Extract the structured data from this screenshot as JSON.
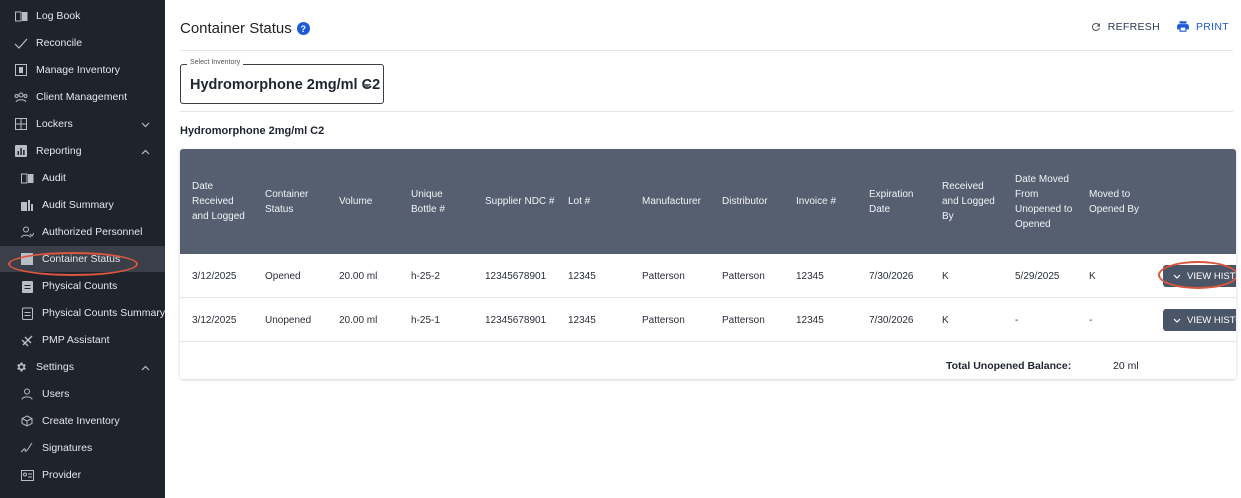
{
  "sidebar": {
    "items": [
      {
        "label": "Log Book",
        "icon": "book-icon"
      },
      {
        "label": "Reconcile",
        "icon": "check-icon"
      },
      {
        "label": "Manage Inventory",
        "icon": "inventory-icon"
      },
      {
        "label": "Client Management",
        "icon": "clients-icon"
      },
      {
        "label": "Lockers",
        "icon": "lockers-icon",
        "chevron": "down"
      },
      {
        "label": "Reporting",
        "icon": "reporting-icon",
        "chevron": "up"
      },
      {
        "label": "Audit",
        "icon": "audit-icon"
      },
      {
        "label": "Audit Summary",
        "icon": "audit-summary-icon"
      },
      {
        "label": "Authorized Personnel",
        "icon": "personnel-icon"
      },
      {
        "label": "Container Status",
        "icon": "container-icon",
        "active": true
      },
      {
        "label": "Physical Counts",
        "icon": "clipboard-icon"
      },
      {
        "label": "Physical Counts Summary",
        "icon": "clipboard-summary-icon"
      },
      {
        "label": "PMP Assistant",
        "icon": "pmp-icon"
      },
      {
        "label": "Settings",
        "icon": "gear-icon",
        "chevron": "up"
      },
      {
        "label": "Users",
        "icon": "user-icon"
      },
      {
        "label": "Create Inventory",
        "icon": "box-icon"
      },
      {
        "label": "Signatures",
        "icon": "signature-icon"
      },
      {
        "label": "Provider",
        "icon": "provider-icon"
      }
    ]
  },
  "header": {
    "title": "Container Status",
    "help": "?",
    "refresh_label": "REFRESH",
    "print_label": "PRINT"
  },
  "select": {
    "legend": "Select Inventory",
    "value": "Hydromorphone 2mg/ml C2"
  },
  "subheading": "Hydromorphone 2mg/ml C2",
  "table": {
    "headers": [
      "Date Received and Logged",
      "Container Status",
      "Volume",
      "Unique Bottle #",
      "Supplier NDC #",
      "Lot #",
      "Manufacturer",
      "Distributor",
      "Invoice #",
      "Expiration Date",
      "Received and Logged By",
      "Date Moved From Unopened to Opened",
      "Moved to Opened By"
    ],
    "rows": [
      {
        "cells": [
          "3/12/2025",
          "Opened",
          "20.00 ml",
          "h-25-2",
          "12345678901",
          "12345",
          "Patterson",
          "Patterson",
          "12345",
          "7/30/2026",
          "K",
          "5/29/2025",
          "K"
        ],
        "action": "VIEW HISTO"
      },
      {
        "cells": [
          "3/12/2025",
          "Unopened",
          "20.00 ml",
          "h-25-1",
          "12345678901",
          "12345",
          "Patterson",
          "Patterson",
          "12345",
          "7/30/2026",
          "K",
          "-",
          "-"
        ],
        "action": "VIEW HISTO"
      }
    ],
    "total_label": "Total Unopened Balance:",
    "total_value": "20 ml"
  },
  "colors": {
    "sidebar_bg": "#1f232b",
    "accent": "#1d5bd6",
    "table_header": "#555f70",
    "highlight": "#d8573d"
  }
}
